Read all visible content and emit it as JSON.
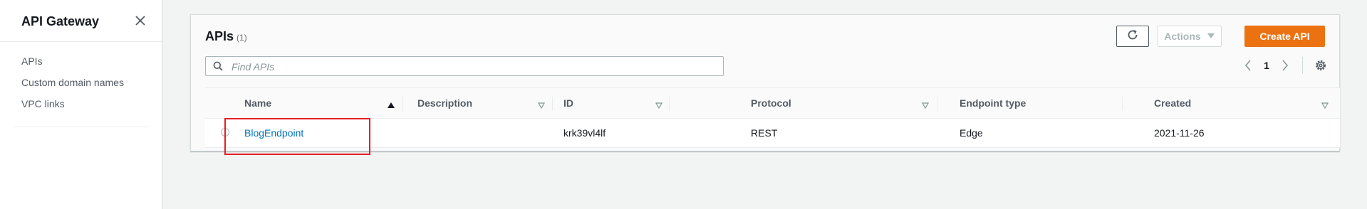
{
  "sidebar": {
    "title": "API Gateway",
    "items": [
      {
        "label": "APIs"
      },
      {
        "label": "Custom domain names"
      },
      {
        "label": "VPC links"
      }
    ]
  },
  "panel": {
    "title": "APIs",
    "count": "(1)",
    "actions_label": "Actions",
    "create_label": "Create API",
    "search_placeholder": "Find APIs",
    "page_number": "1"
  },
  "table": {
    "columns": [
      "Name",
      "Description",
      "ID",
      "Protocol",
      "Endpoint type",
      "Created"
    ],
    "rows": [
      {
        "name": "BlogEndpoint",
        "description": "",
        "id": "krk39vl4lf",
        "protocol": "REST",
        "endpoint_type": "Edge",
        "created": "2021-11-26"
      }
    ]
  },
  "colors": {
    "accent": "#ec7211",
    "link": "#0073bb",
    "highlight": "#e81e25"
  },
  "icons": [
    "close-icon",
    "refresh-icon",
    "caret-down-icon",
    "search-icon",
    "chevron-left-icon",
    "chevron-right-icon",
    "gear-icon",
    "sort-asc-icon",
    "sort-icon"
  ]
}
